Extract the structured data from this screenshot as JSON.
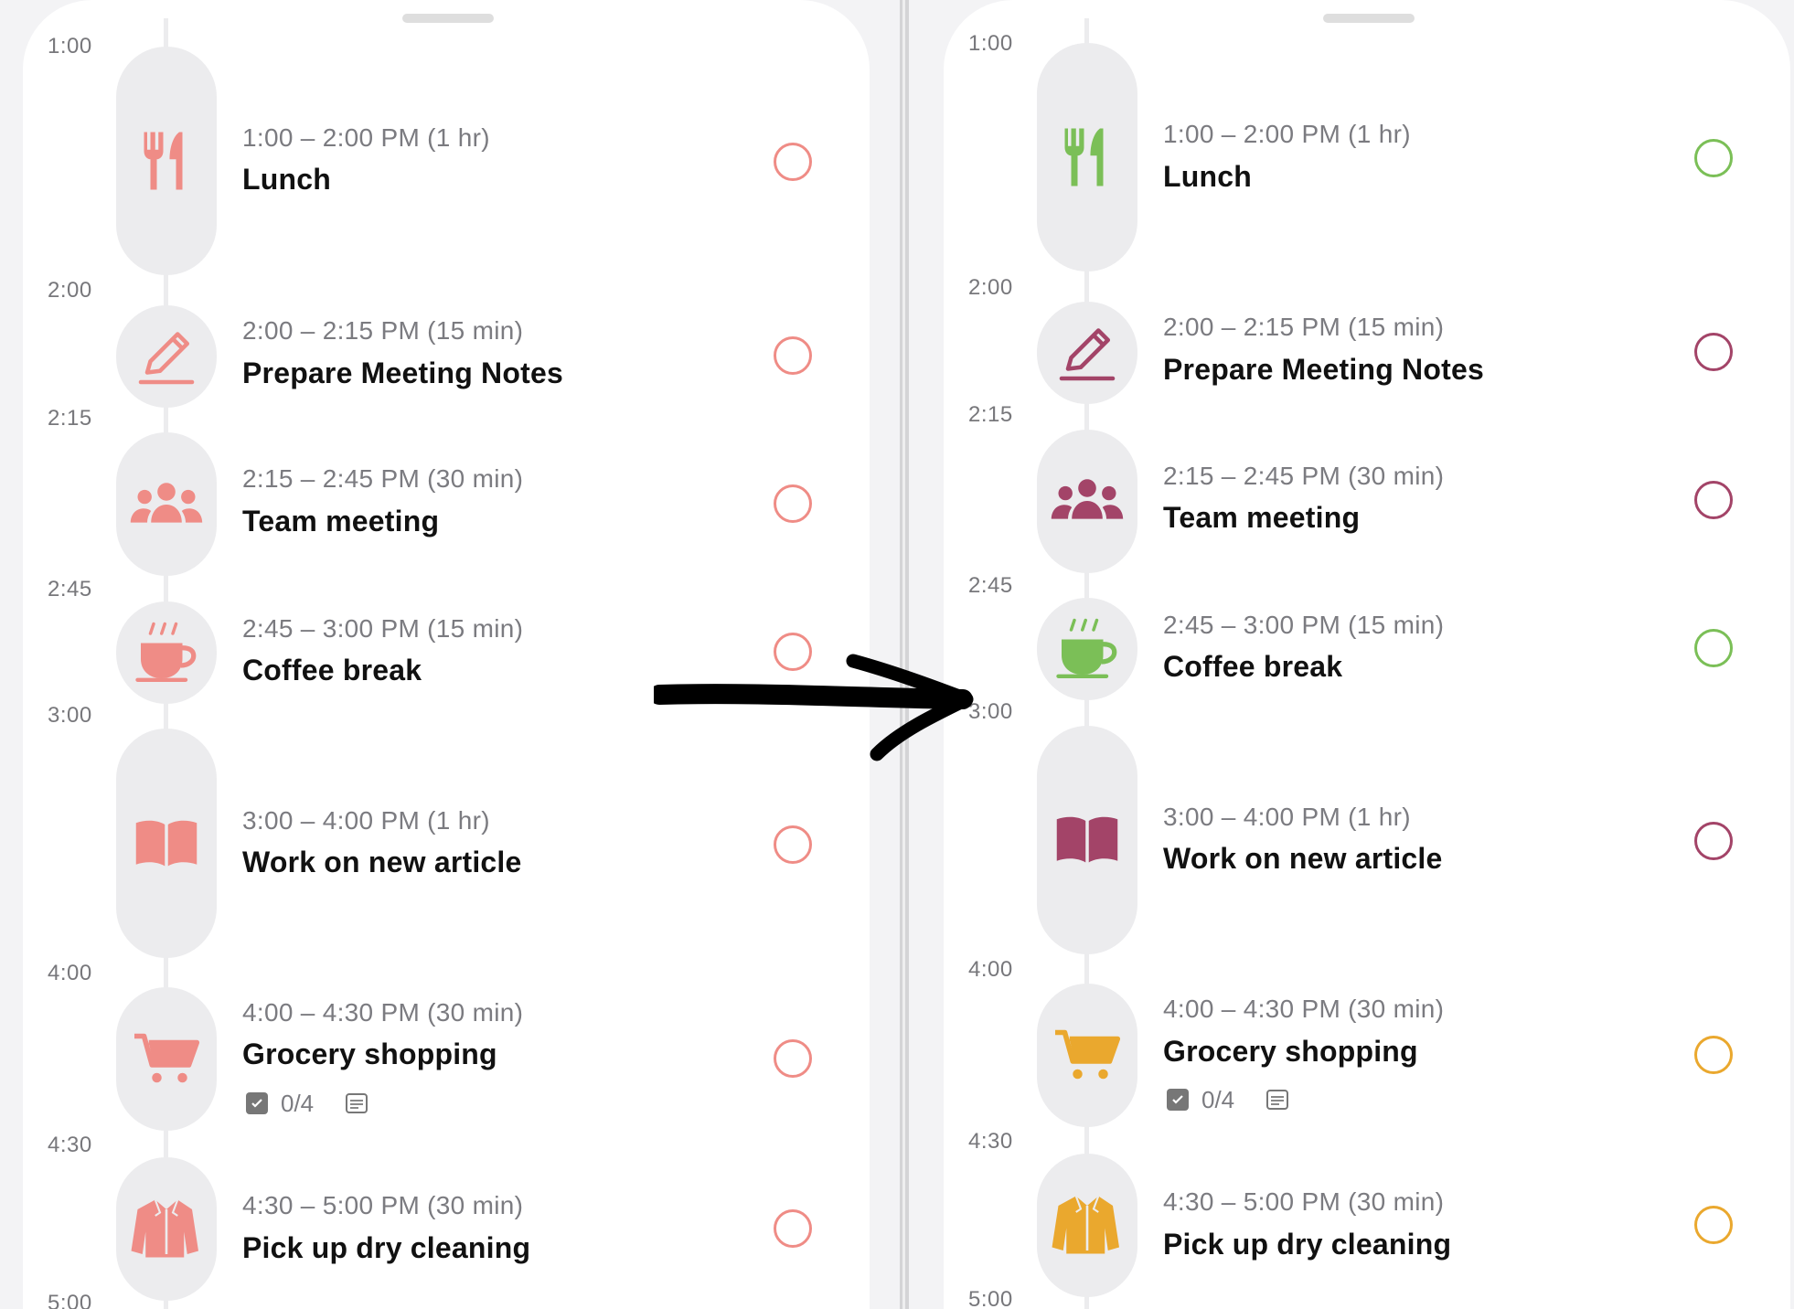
{
  "colors": {
    "left": {
      "accent": "#ef8c86"
    },
    "right": {
      "green": "#7bbf57",
      "plum": "#a34468",
      "gold": "#eaa82e"
    }
  },
  "time_labels": [
    "1:00",
    "2:00",
    "2:15",
    "2:45",
    "3:00",
    "4:00",
    "4:30",
    "5:00"
  ],
  "tasks": [
    {
      "time": "1:00 – 2:00 PM (1 hr)",
      "title": "Lunch",
      "icon": "fork-knife-icon",
      "right_color": "green"
    },
    {
      "time": "2:00 – 2:15 PM (15 min)",
      "title": "Prepare Meeting Notes",
      "icon": "pencil-icon",
      "right_color": "plum"
    },
    {
      "time": "2:15 – 2:45 PM (30 min)",
      "title": "Team meeting",
      "icon": "group-icon",
      "right_color": "plum"
    },
    {
      "time": "2:45 – 3:00 PM (15 min)",
      "title": "Coffee break",
      "icon": "coffee-cup-icon",
      "right_color": "green"
    },
    {
      "time": "3:00 – 4:00 PM (1 hr)",
      "title": "Work on new article",
      "icon": "book-icon",
      "right_color": "plum"
    },
    {
      "time": "4:00 – 4:30 PM (30 min)",
      "title": "Grocery shopping",
      "icon": "cart-icon",
      "right_color": "gold",
      "subtasks": "0/4",
      "has_notes": true
    },
    {
      "time": "4:30 – 5:00 PM (30 min)",
      "title": "Pick up dry cleaning",
      "icon": "jacket-icon",
      "right_color": "gold"
    }
  ],
  "annotation": {
    "icon": "hand-drawn-arrow-icon"
  }
}
